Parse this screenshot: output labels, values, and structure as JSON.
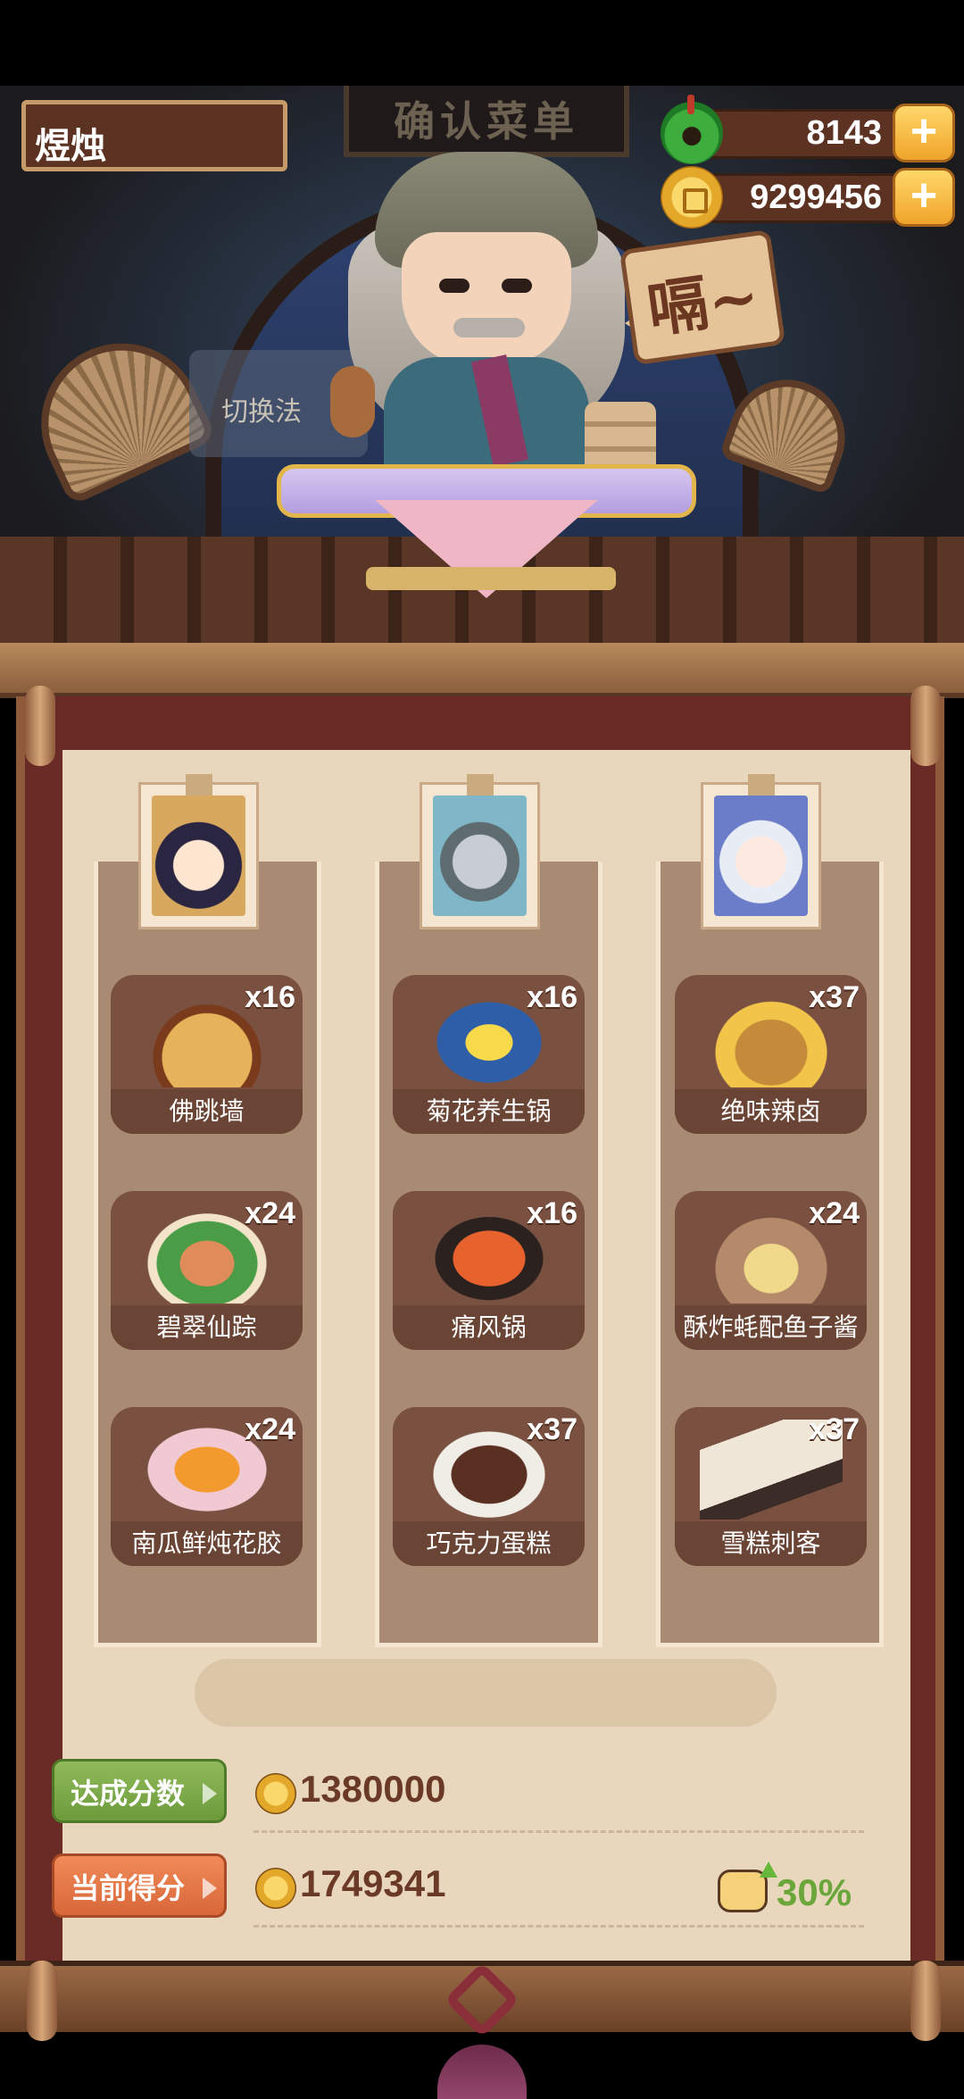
{
  "player": {
    "name": "煜烛"
  },
  "currencies": [
    {
      "icon": "jade-icon",
      "value": "8143",
      "add_label": "+"
    },
    {
      "icon": "coin-icon",
      "value": "9299456",
      "add_label": "+"
    }
  ],
  "scene": {
    "sign": "确认菜单",
    "speech": "嗝~",
    "note": "切换法"
  },
  "columns": [
    {
      "portrait": "character-1",
      "dishes": [
        {
          "name": "佛跳墙",
          "count": "x16",
          "art": "pot"
        },
        {
          "name": "碧翠仙踪",
          "count": "x24",
          "art": "jade"
        },
        {
          "name": "南瓜鲜炖花胶",
          "count": "x24",
          "art": "pumpkin"
        }
      ]
    },
    {
      "portrait": "character-2",
      "dishes": [
        {
          "name": "菊花养生锅",
          "count": "x16",
          "art": "hotpot"
        },
        {
          "name": "痛风锅",
          "count": "x16",
          "art": "wok"
        },
        {
          "name": "巧克力蛋糕",
          "count": "x37",
          "art": "cake"
        }
      ]
    },
    {
      "portrait": "character-3",
      "dishes": [
        {
          "name": "绝味辣卤",
          "count": "x37",
          "art": "spicy"
        },
        {
          "name": "酥炸蚝配鱼子酱",
          "count": "x24",
          "art": "oyster"
        },
        {
          "name": "雪糕刺客",
          "count": "x37",
          "art": "icecream"
        }
      ]
    }
  ],
  "scores": {
    "target": {
      "label": "达成分数",
      "value": "1380000"
    },
    "current": {
      "label": "当前得分",
      "value": "1749341"
    },
    "bonus": "30%"
  },
  "colors": {
    "panel": "#6a2a26",
    "paper": "#e8d6bd",
    "dish_card": "#7a5140",
    "target_tag": "#7aa64a",
    "current_tag": "#e2764a",
    "bonus_text": "#6aa63a"
  }
}
